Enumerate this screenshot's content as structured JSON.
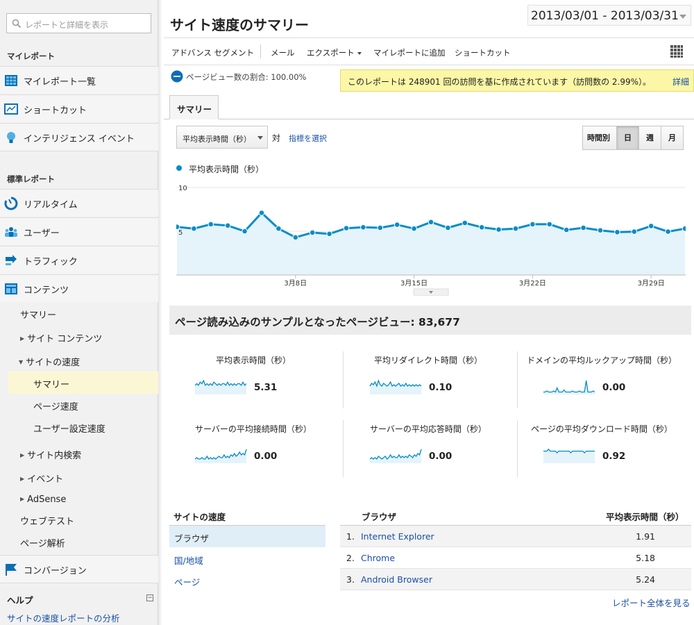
{
  "sidebar": {
    "search_placeholder": "レポートと詳細を表示",
    "my_reports_heading": "マイレポート",
    "my_reports": [
      {
        "label": "マイレポート一覧",
        "icon": "dashboard-grid-icon"
      },
      {
        "label": "ショートカット",
        "icon": "shortcut-icon"
      },
      {
        "label": "インテリジェンス イベント",
        "icon": "lightbulb-icon"
      }
    ],
    "standard_heading": "標準レポート",
    "standard": [
      {
        "label": "リアルタイム",
        "icon": "realtime-icon"
      },
      {
        "label": "ユーザー",
        "icon": "users-icon"
      },
      {
        "label": "トラフィック",
        "icon": "traffic-arrow-icon"
      },
      {
        "label": "コンテンツ",
        "icon": "content-icon"
      }
    ],
    "content_sub": {
      "summary": "サマリー",
      "site_content": "サイト コンテンツ",
      "site_speed": "サイトの速度",
      "speed_summary": "サマリー",
      "page_speed": "ページ速度",
      "user_timings": "ユーザー設定速度",
      "site_search": "サイト内検索",
      "events": "イベント",
      "adsense": "AdSense",
      "webtest": "ウェブテスト",
      "page_analytics": "ページ解析"
    },
    "conversion": {
      "label": "コンバージョン",
      "icon": "flag-icon"
    },
    "help_heading": "ヘルプ",
    "help_collapse": "⊖",
    "help_link": "サイトの速度レポートの分析"
  },
  "header": {
    "title": "サイト速度のサマリー",
    "date_range": "2013/03/01 - 2013/03/31"
  },
  "toolbar": {
    "advanced_segment": "アドバンス セグメント",
    "email": "メール",
    "export": "エクスポート",
    "add_to_dashboard": "マイレポートに追加",
    "shortcut": "ショートカット"
  },
  "segment": {
    "text": "ページビュー数の割合: 100.00%"
  },
  "notice": {
    "text": "このレポートは 248901 回の訪問を基に作成されています（訪問数の 2.99%）。",
    "more": "詳細"
  },
  "tabs": {
    "summary": "サマリー"
  },
  "controls": {
    "metric": "平均表示時間（秒）",
    "vs": "対",
    "choose_metric": "指標を選択",
    "granularity": [
      "時間別",
      "日",
      "週",
      "月"
    ],
    "granularity_active": "日"
  },
  "chart_data": {
    "type": "area",
    "series": [
      {
        "name": "平均表示時間（秒）",
        "color": "#058dc7"
      }
    ],
    "y_ticks": [
      "10",
      "5"
    ],
    "ylim": [
      0,
      10
    ],
    "x_labels": [
      "3月8日",
      "3月15日",
      "3月22日",
      "3月29日"
    ],
    "x_label_days": [
      8,
      15,
      22,
      29
    ],
    "x_days": [
      1,
      2,
      3,
      4,
      5,
      6,
      7,
      8,
      9,
      10,
      11,
      12,
      13,
      14,
      15,
      16,
      17,
      18,
      19,
      20,
      21,
      22,
      23,
      24,
      25,
      26,
      27,
      28,
      29,
      30,
      31
    ],
    "values": [
      5.5,
      5.3,
      5.8,
      5.65,
      5.0,
      7.1,
      5.3,
      4.3,
      4.85,
      4.7,
      5.35,
      5.45,
      5.4,
      5.75,
      5.3,
      6.05,
      5.4,
      5.95,
      5.45,
      5.2,
      5.3,
      5.8,
      5.8,
      5.15,
      5.4,
      5.1,
      4.9,
      4.95,
      5.6,
      4.95,
      5.3
    ]
  },
  "sample": {
    "label": "ページ読み込みのサンプルとなったページビュー: 83,677"
  },
  "metrics": [
    {
      "title": "平均表示時間（秒）",
      "value": "5.31",
      "spark": [
        5,
        6,
        5,
        7,
        6,
        8,
        5,
        6,
        5,
        6,
        5,
        7,
        6,
        5,
        6,
        5,
        6,
        6,
        5,
        7,
        5,
        6,
        5,
        6,
        5,
        6,
        6,
        5,
        7,
        5,
        6
      ]
    },
    {
      "title": "平均リダイレクト時間（秒）",
      "value": "0.10",
      "spark": [
        5,
        7,
        6,
        8,
        5,
        9,
        6,
        5,
        7,
        6,
        5,
        6,
        8,
        5,
        6,
        5,
        6,
        7,
        5,
        6,
        5,
        7,
        5,
        6,
        5,
        6,
        5,
        6,
        5,
        6,
        5
      ]
    },
    {
      "title": "ドメインの平均ルックアップ時間（秒）",
      "value": "0.00",
      "spark": [
        1,
        1,
        2,
        1,
        1,
        1,
        2,
        1,
        5,
        1,
        1,
        1,
        3,
        1,
        1,
        1,
        1,
        2,
        1,
        1,
        1,
        2,
        1,
        1,
        1,
        12,
        1,
        1,
        1,
        2,
        1
      ]
    },
    {
      "title": "サーバーの平均接続時間（秒）",
      "value": "0.00",
      "spark": [
        2,
        3,
        2,
        2,
        3,
        2,
        2,
        4,
        2,
        3,
        2,
        3,
        2,
        3,
        4,
        3,
        3,
        5,
        3,
        4,
        3,
        5,
        4,
        6,
        4,
        5,
        7,
        5,
        6,
        5,
        9
      ]
    },
    {
      "title": "サーバーの平均応答時間（秒）",
      "value": "0.00",
      "spark": [
        2,
        3,
        2,
        3,
        2,
        4,
        3,
        2,
        3,
        4,
        2,
        3,
        5,
        3,
        4,
        3,
        3,
        5,
        3,
        4,
        3,
        4,
        3,
        5,
        4,
        3,
        5,
        4,
        6,
        5,
        9
      ]
    },
    {
      "title": "ページの平均ダウンロード時間（秒）",
      "value": "0.92",
      "spark": [
        6,
        6,
        6,
        7,
        6,
        6,
        6,
        6,
        5,
        6,
        6,
        6,
        6,
        6,
        6,
        6,
        5,
        6,
        6,
        6,
        6,
        6,
        6,
        6,
        5,
        6,
        6,
        6,
        6,
        6,
        6
      ]
    }
  ],
  "dimension_table": {
    "heading": "サイトの速度",
    "items": [
      "ブラウザ",
      "国/地域",
      "ページ"
    ],
    "active": "ブラウザ"
  },
  "browser_table": {
    "col1": "ブラウザ",
    "col2": "平均表示時間（秒）",
    "rows": [
      {
        "n": "1.",
        "name": "Internet Explorer",
        "value": "1.91"
      },
      {
        "n": "2.",
        "name": "Chrome",
        "value": "5.18"
      },
      {
        "n": "3.",
        "name": "Android Browser",
        "value": "5.24"
      }
    ],
    "full_report": "レポート全体を見る"
  },
  "colors": {
    "accent": "#058dc7",
    "link": "#1a4fa5",
    "notice_bg": "#fbf7a6"
  }
}
